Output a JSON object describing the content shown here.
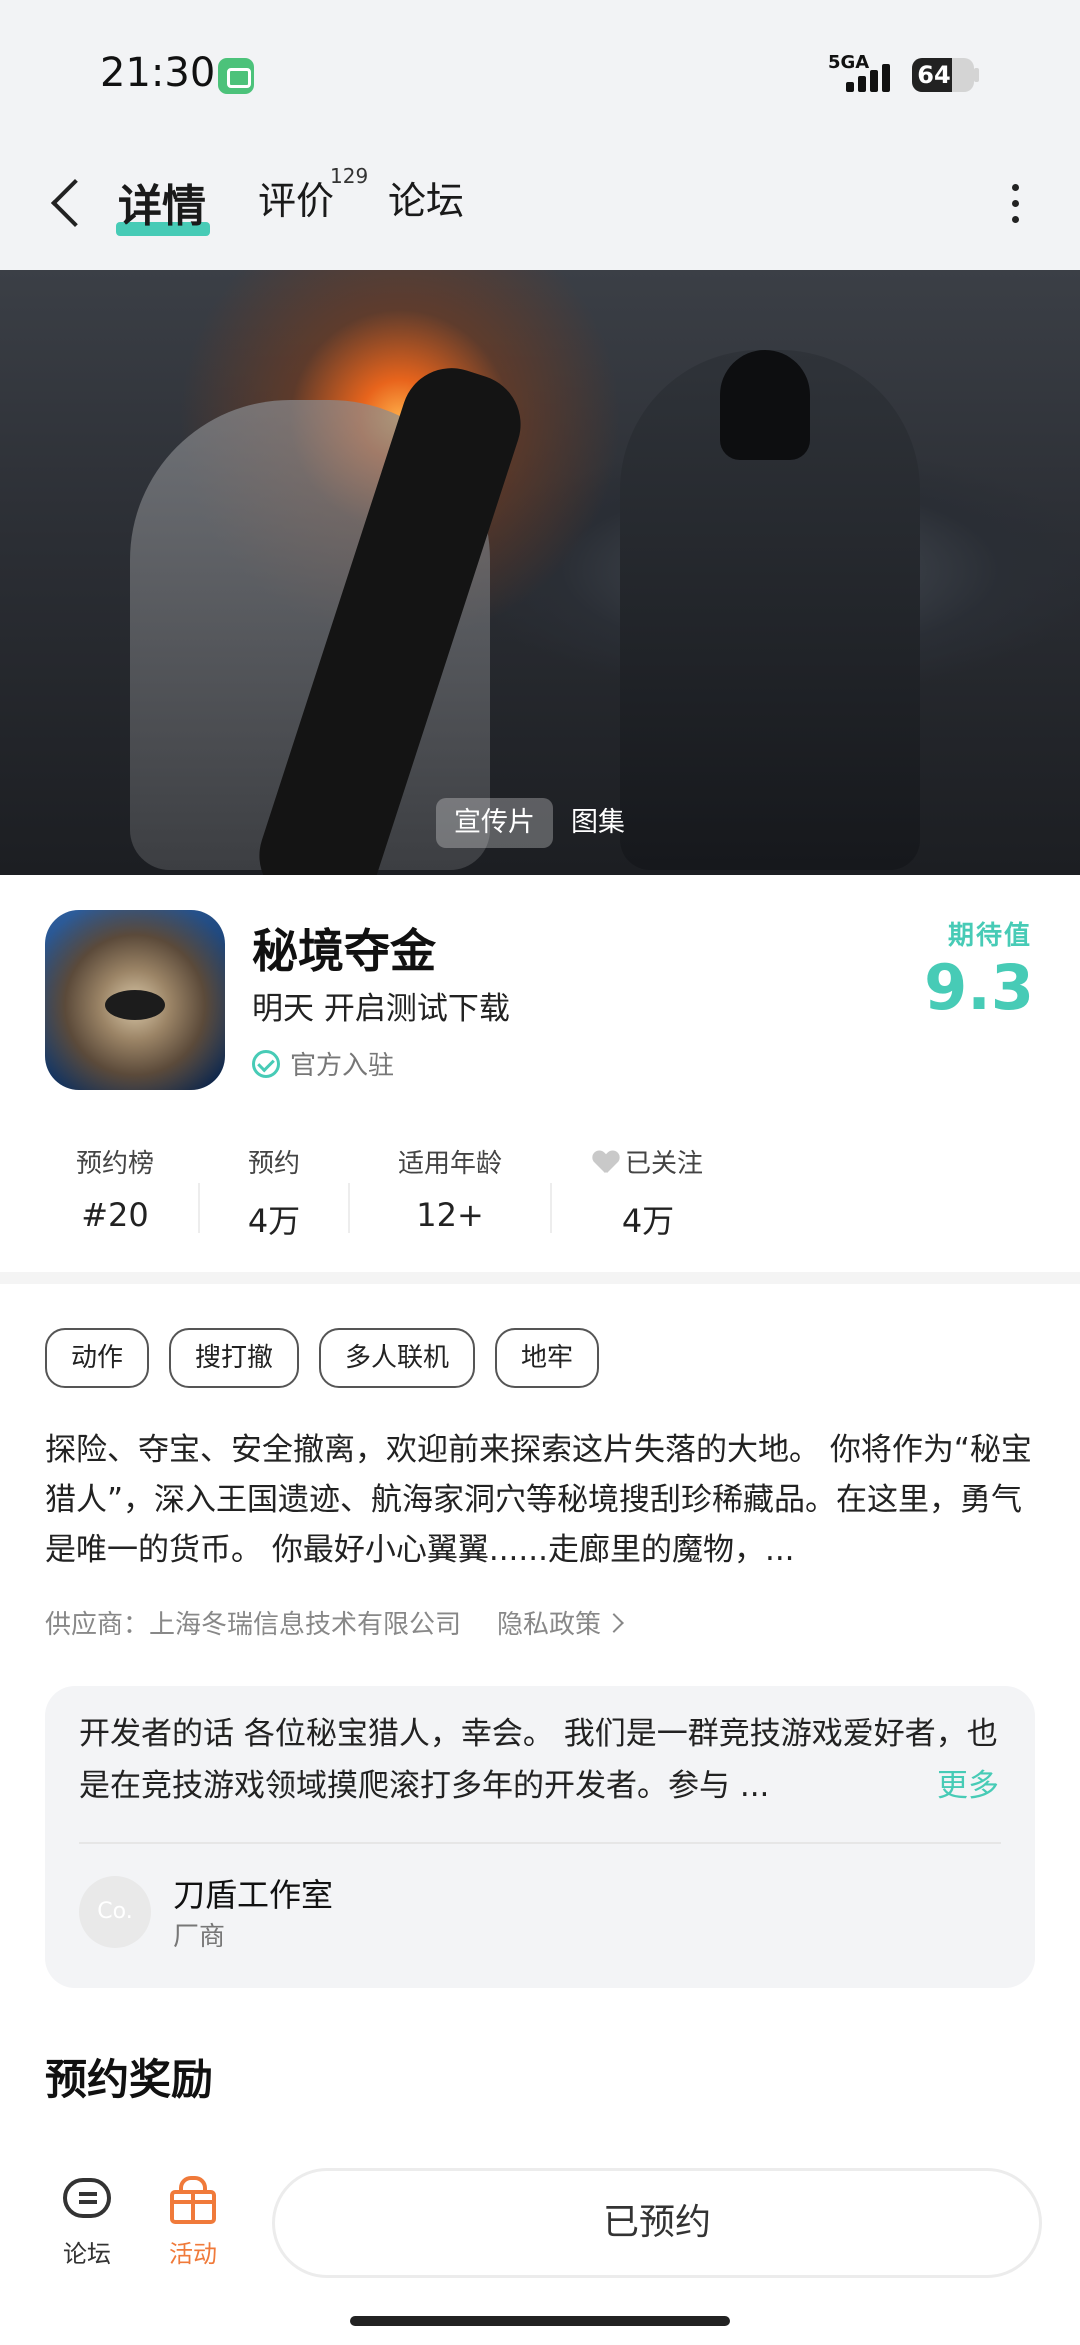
{
  "status_bar": {
    "time": "21:30",
    "network": "5GA",
    "battery": "64",
    "battery_level": 0.64
  },
  "nav": {
    "tabs": [
      {
        "label": "详情",
        "active": true
      },
      {
        "label": "评价",
        "badge": "129"
      },
      {
        "label": "论坛"
      }
    ]
  },
  "hero": {
    "media_tabs": [
      {
        "label": "宣传片",
        "active": true
      },
      {
        "label": "图集"
      }
    ]
  },
  "app": {
    "title": "秘境夺金",
    "subtitle": "明天 开启测试下载",
    "official": "官方入驻",
    "expect_label": "期待值",
    "expect_score": "9.3",
    "accent_color": "#47cbb6"
  },
  "stats": [
    {
      "label": "预约榜",
      "value": "#20"
    },
    {
      "label": "预约",
      "value": "4万"
    },
    {
      "label": "适用年龄",
      "value": "12+"
    },
    {
      "label": "已关注",
      "value": "4万"
    }
  ],
  "tags": [
    "动作",
    "搜打撤",
    "多人联机",
    "地牢"
  ],
  "description": "探险、夺宝、安全撤离，欢迎前来探索这片失落的大地。 你将作为“秘宝猎人”，深入王国遗迹、航海家洞穴等秘境搜刮珍稀藏品。在这里，勇气是唯一的货币。 你最好小心翼翼......走廊里的魔物，...",
  "provider": {
    "label": "供应商：上海冬瑞信息技术有限公司",
    "privacy": "隐私政策"
  },
  "developer": {
    "text": "开发者的话  各位秘宝猎人，幸会。 我们是一群竞技游戏爱好者，也是在竞技游戏领域摸爬滚打多年的开发者。参与 ...",
    "more": "更多",
    "avatar": "Co.",
    "name": "刀盾工作室",
    "role": "厂商"
  },
  "section_title": "预约奖励",
  "bottom_bar": {
    "forum": "论坛",
    "activity": "活动",
    "reserved": "已预约",
    "activity_color": "#f07a3a"
  }
}
